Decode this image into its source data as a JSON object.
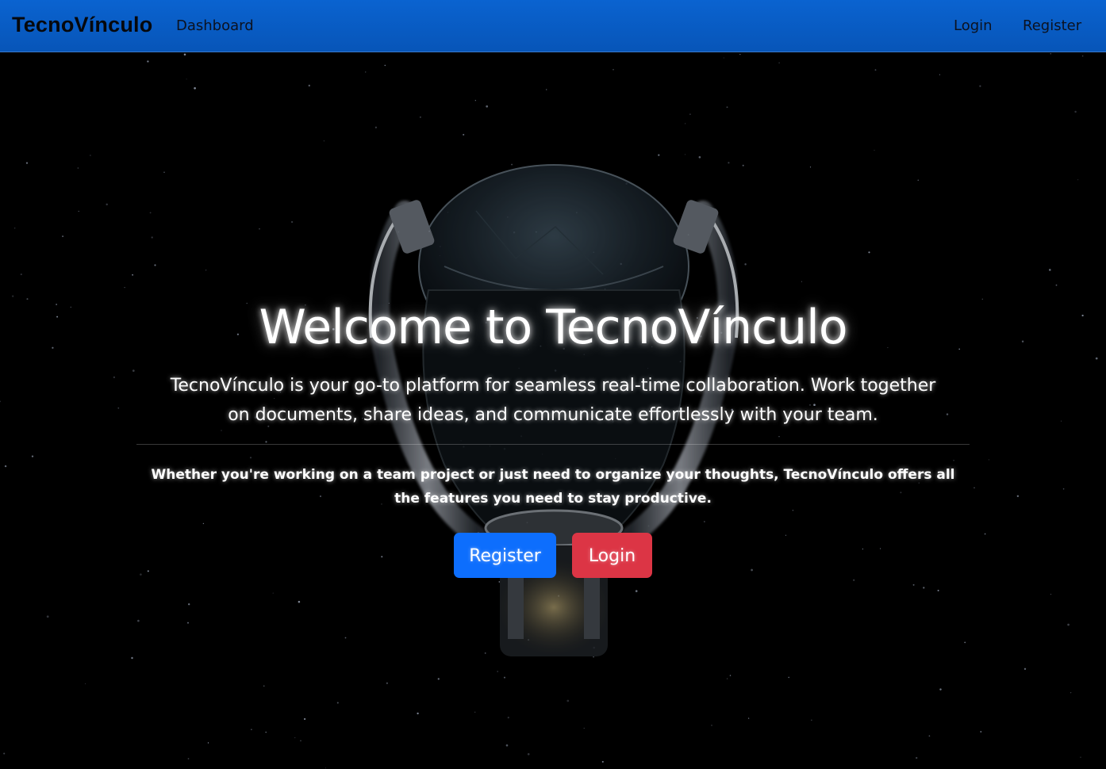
{
  "navbar": {
    "brand": "TecnoVínculo",
    "dashboard_label": "Dashboard",
    "login_label": "Login",
    "register_label": "Register",
    "color": "#0a63d0"
  },
  "hero": {
    "title": "Welcome to TecnoVínculo",
    "lead": "TecnoVínculo is your go-to platform for seamless real-time collaboration. Work together on documents, share ideas, and communicate effortlessly with your team.",
    "subtext": "Whether you're working on a team project or just need to organize your thoughts, TecnoVínculo offers all the features you need to stay productive.",
    "register_button": "Register",
    "login_button": "Login",
    "register_color": "#0d6efd",
    "login_color": "#dc3545",
    "background_image": "robot-helmet-space-image"
  }
}
